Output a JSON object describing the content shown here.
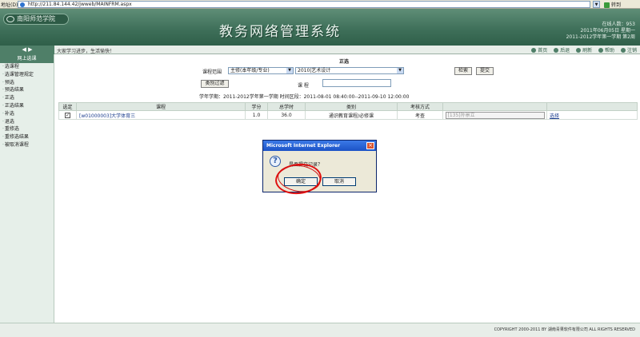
{
  "address_bar": {
    "label": "地址(D)",
    "url": "http://211.84.144.42/jwweb/MAINFRM.aspx",
    "go": "转到"
  },
  "banner": {
    "logo": "南阳师范学院",
    "title": "教务网络管理系统",
    "online": "在线人数：953",
    "date": "2011年06月05日 星期一",
    "term": "2011-2012学年第一学期 第2周"
  },
  "toolbar": {
    "marquee": "大家学习进步，生活愉快！",
    "nav": [
      "首页",
      "后退",
      "刷新",
      "帮助",
      "注销"
    ]
  },
  "sidebar": {
    "header": "网上选课",
    "items": [
      "选课程",
      "选课管理规定",
      "预选",
      "预选结果",
      "正选",
      "正选结果",
      "补选",
      "退选",
      "重修选",
      "重修选结果",
      "被取消课程"
    ]
  },
  "form": {
    "title": "正选",
    "range_label": "课程范围",
    "range_value": "主修(本年级/专业)",
    "major_value": "2010|艺术设计",
    "search_btn": "检索",
    "submit_btn": "提交",
    "filter_btn": "类别过滤",
    "course_label": "课 程",
    "term_info": "学年学期：2011-2012学年第一学期 时间区段：2011-08-01 08:40:00--2011-09-10 12:00:00"
  },
  "table": {
    "headers": [
      "选定",
      "课程",
      "学分",
      "总学时",
      "类别",
      "考核方式",
      "",
      ""
    ],
    "rows": [
      {
        "check": "✓",
        "course": "[w01000003]大学体育三",
        "credit": "1.0",
        "hours": "36.0",
        "category": "通识教育课程/必修课",
        "exam": "考查",
        "seat": "[135]孙景立",
        "action": "选择"
      }
    ]
  },
  "dialog": {
    "title": "Microsoft Internet Explorer",
    "message": "是否提交记录？",
    "ok": "确定",
    "cancel": "取消"
  },
  "footer": {
    "copyright": "COPYRIGHT 2000-2011 BY 湖南青果软件有限公司 ALL RIGHTS RESERVED"
  }
}
